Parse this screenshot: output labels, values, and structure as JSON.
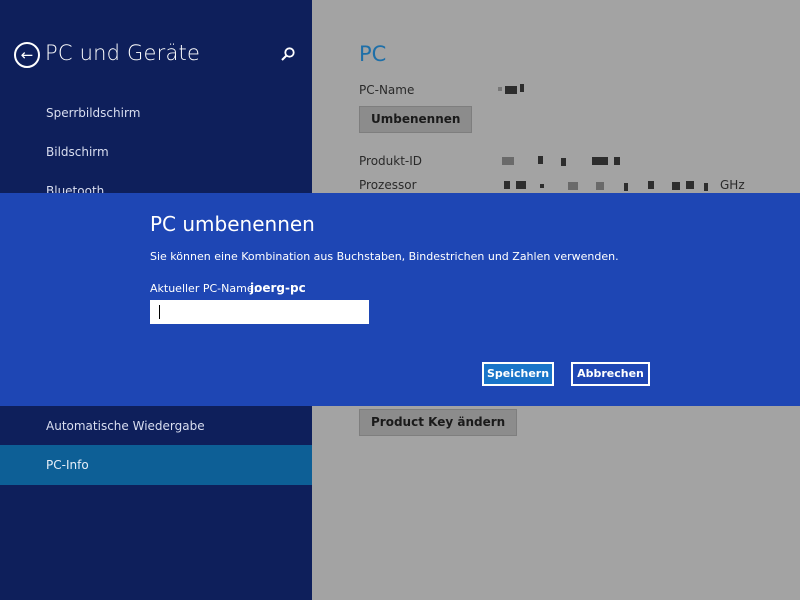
{
  "left_pane": {
    "title": "PC und Geräte",
    "nav_items": [
      {
        "label": "Sperrbildschirm"
      },
      {
        "label": "Bildschirm"
      },
      {
        "label": "Bluetooth"
      },
      {
        "label": "Automatische Wiedergabe"
      },
      {
        "label": "PC-Info"
      }
    ],
    "selected_item": "PC-Info"
  },
  "right_pane": {
    "title": "PC",
    "pc_name_label": "PC-Name",
    "rename_button": "Umbenennen",
    "product_id_label": "Produkt-ID",
    "processor_label": "Prozessor",
    "processor_unit": "GHz",
    "product_key_button": "Product Key ändern"
  },
  "dialog": {
    "title": "PC umbenennen",
    "description": "Sie können eine Kombination aus Buchstaben, Bindestrichen und Zahlen verwenden.",
    "current_name_label": "Aktueller PC-Name:",
    "current_name_value": "joerg-pc",
    "input_value": "",
    "save_button": "Speichern",
    "cancel_button": "Abbrechen"
  },
  "colors": {
    "left_background": "#0e1f5b",
    "selected_item": "#0d5f96",
    "dialog_background": "#1e46b4",
    "save_button": "#1a75c9",
    "right_dimmed": "#a3a3a3",
    "accent_title": "#1e6fa8"
  }
}
